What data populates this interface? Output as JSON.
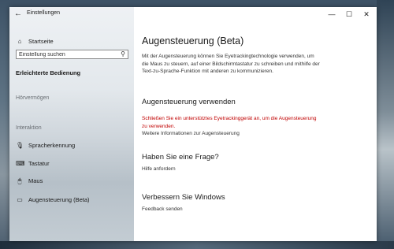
{
  "window": {
    "title": "Einstellungen",
    "controls": {
      "minimize": "—",
      "maximize": "☐",
      "close": "✕"
    }
  },
  "sidebar": {
    "home": {
      "label": "Startseite",
      "icon": "home-icon"
    },
    "search": {
      "placeholder": "Einstellung suchen",
      "icon": "search-icon"
    },
    "category": "Erleichterte Bedienung",
    "sections": [
      {
        "heading": "Hörvermögen"
      },
      {
        "heading": "Interaktion"
      }
    ],
    "items": [
      {
        "label": "Spracherkennung",
        "icon": "microphone-icon"
      },
      {
        "label": "Tastatur",
        "icon": "keyboard-icon"
      },
      {
        "label": "Maus",
        "icon": "mouse-icon"
      },
      {
        "label": "Augensteuerung (Beta)",
        "icon": "eye-control-icon"
      }
    ]
  },
  "main": {
    "title": "Augensteuerung (Beta)",
    "description": "Mit der Augensteuerung können Sie Eyetrackingtechnologie verwenden, um die Maus zu steuern, auf einer Bildschirmtastatur zu schreiben und mithilfe der Text-zu-Sprache-Funktion mit anderen zu kommunizieren.",
    "use_heading": "Augensteuerung verwenden",
    "warning": "Schließen Sie ein unterstütztes Eyetrackinggerät an, um die Augensteuerung zu verwenden.",
    "more_info_link": "Weitere Informationen zur Augensteuerung",
    "question_heading": "Haben Sie eine Frage?",
    "help_link": "Hilfe anfordern",
    "improve_heading": "Verbessern Sie Windows",
    "feedback_link": "Feedback senden"
  },
  "colors": {
    "warning": "#c00000",
    "sidebar_bg": "#e3e8ec"
  }
}
